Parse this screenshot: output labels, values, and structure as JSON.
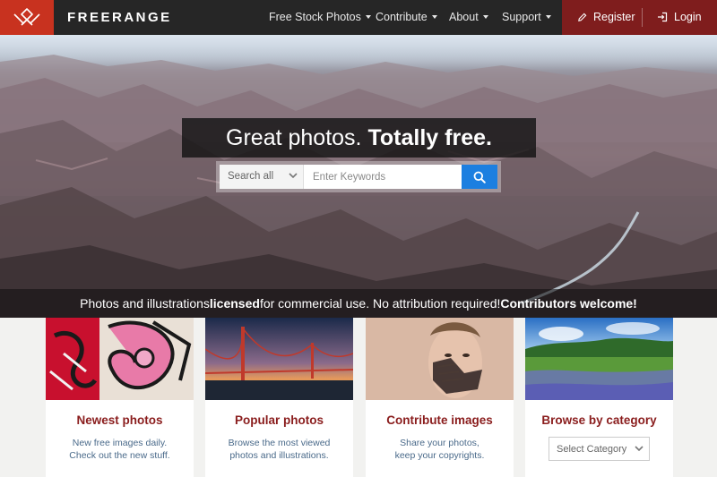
{
  "brand": {
    "name": "FREERANGE"
  },
  "nav": {
    "items": [
      {
        "label": "Free Stock Photos"
      },
      {
        "label": "Contribute"
      },
      {
        "label": "About"
      },
      {
        "label": "Support"
      }
    ],
    "register_label": "Register",
    "login_label": "Login"
  },
  "hero": {
    "headline_regular": "Great photos.",
    "headline_bold": "Totally free.",
    "search": {
      "scope_value": "Search all",
      "placeholder": "Enter Keywords",
      "value": ""
    },
    "tagline": {
      "part1": "Photos and illustrations ",
      "bold1": "licensed",
      "part2": " for commercial use. No attribution required! ",
      "bold2": "Contributors welcome!"
    }
  },
  "cards": [
    {
      "title": "Newest photos",
      "desc1": "New free images daily.",
      "desc2": "Check out the new stuff."
    },
    {
      "title": "Popular photos",
      "desc1": "Browse the most viewed",
      "desc2": "photos and illustrations."
    },
    {
      "title": "Contribute images",
      "desc1": "Share your photos,",
      "desc2": "keep your copyrights."
    },
    {
      "title": "Browse by category",
      "select_value": "Select Category"
    }
  ],
  "colors": {
    "brand_red": "#c8321f",
    "auth_bg": "#7f1d1d",
    "nav_bg": "#262626",
    "search_button": "#1c7fe0",
    "card_title": "#8a1d1d"
  }
}
